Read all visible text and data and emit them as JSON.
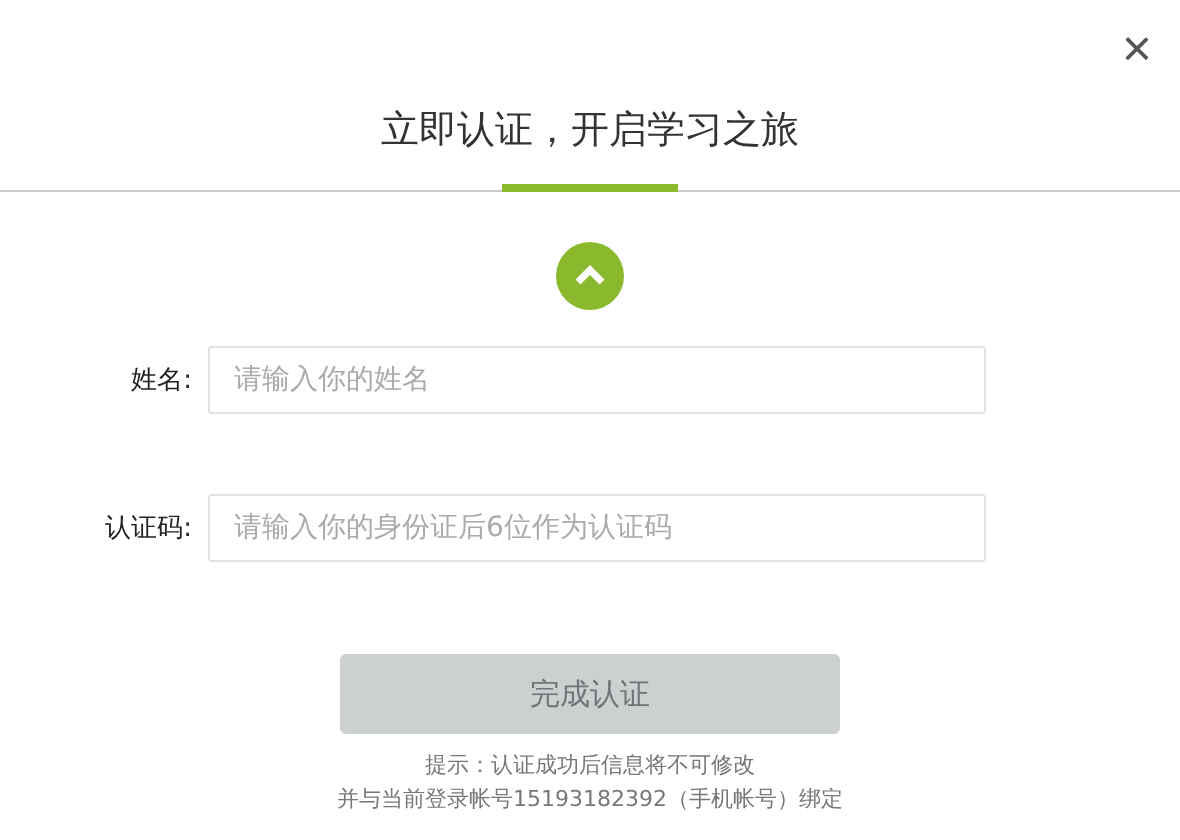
{
  "dialog": {
    "title": "立即认证，开启学习之旅",
    "close": "×"
  },
  "fields": [
    {
      "label": "姓名:",
      "placeholder": "请输入你的姓名"
    },
    {
      "label": "认证码:",
      "placeholder": "请输入你的身份证后6位作为认证码"
    }
  ],
  "submit": {
    "label": "完成认证",
    "disabled": true
  },
  "notes": [
    "提示：认证成功后信息将不可修改",
    "并与当前登录帐号15193182392（手机帐号）绑定"
  ]
}
